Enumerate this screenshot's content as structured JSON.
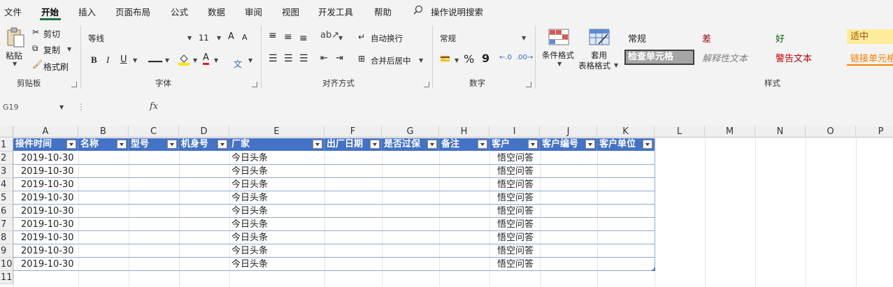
{
  "menu": {
    "items": [
      "文件",
      "开始",
      "插入",
      "页面布局",
      "公式",
      "数据",
      "审阅",
      "视图",
      "开发工具",
      "帮助"
    ],
    "active": "开始",
    "search_label": "操作说明搜索"
  },
  "ribbon": {
    "clipboard": {
      "paste": "粘贴",
      "cut": "剪切",
      "copy": "复制",
      "format_painter": "格式刷",
      "label": "剪贴板"
    },
    "font": {
      "name": "等线",
      "size": "11",
      "grow": "A",
      "shrink": "A",
      "bold": "B",
      "italic": "I",
      "underline": "U",
      "phonetic": "文",
      "label": "字体"
    },
    "alignment": {
      "wrap": "自动换行",
      "merge": "合并后居中",
      "label": "对齐方式"
    },
    "number": {
      "format": "常规",
      "percent": "%",
      "comma": "9",
      "label": "数字"
    },
    "styles": {
      "conditional": "条件格式",
      "table_format_1": "套用",
      "table_format_2": "表格格式",
      "normal": "常规",
      "bad": "差",
      "good": "好",
      "neutral": "适中",
      "check_cell": "检查单元格",
      "explanatory": "解释性文本",
      "warning": "警告文本",
      "linked_cell": "链接单元格",
      "label": "样式"
    }
  },
  "formula_bar": {
    "name_box": "G19",
    "fx": "fx"
  },
  "sheet": {
    "columns": [
      "A",
      "B",
      "C",
      "D",
      "E",
      "F",
      "G",
      "H",
      "I",
      "J",
      "K",
      "L",
      "M",
      "N",
      "O",
      "P"
    ],
    "headers": [
      "接件时间",
      "名称",
      "型号",
      "机身号",
      "厂家",
      "出厂日期",
      "是否过保",
      "备注",
      "客户",
      "客户编号",
      "客户单位"
    ],
    "rows": [
      {
        "n": "2",
        "date": "2019-10-30",
        "maker": "今日头条",
        "client": "悟空问答"
      },
      {
        "n": "3",
        "date": "2019-10-30",
        "maker": "今日头条",
        "client": "悟空问答"
      },
      {
        "n": "4",
        "date": "2019-10-30",
        "maker": "今日头条",
        "client": "悟空问答"
      },
      {
        "n": "5",
        "date": "2019-10-30",
        "maker": "今日头条",
        "client": "悟空问答"
      },
      {
        "n": "6",
        "date": "2019-10-30",
        "maker": "今日头条",
        "client": "悟空问答"
      },
      {
        "n": "7",
        "date": "2019-10-30",
        "maker": "今日头条",
        "client": "悟空问答"
      },
      {
        "n": "8",
        "date": "2019-10-30",
        "maker": "今日头条",
        "client": "悟空问答"
      },
      {
        "n": "9",
        "date": "2019-10-30",
        "maker": "今日头条",
        "client": "悟空问答"
      },
      {
        "n": "10",
        "date": "2019-10-30",
        "maker": "今日头条",
        "client": "悟空问答"
      }
    ],
    "row_numbers": [
      "1",
      "2",
      "3",
      "4",
      "5",
      "6",
      "7",
      "8",
      "9",
      "10",
      "11"
    ],
    "colors": {
      "header_fill": "#4472c4",
      "row_line": "#8ea9db",
      "accent": "#217346"
    }
  }
}
